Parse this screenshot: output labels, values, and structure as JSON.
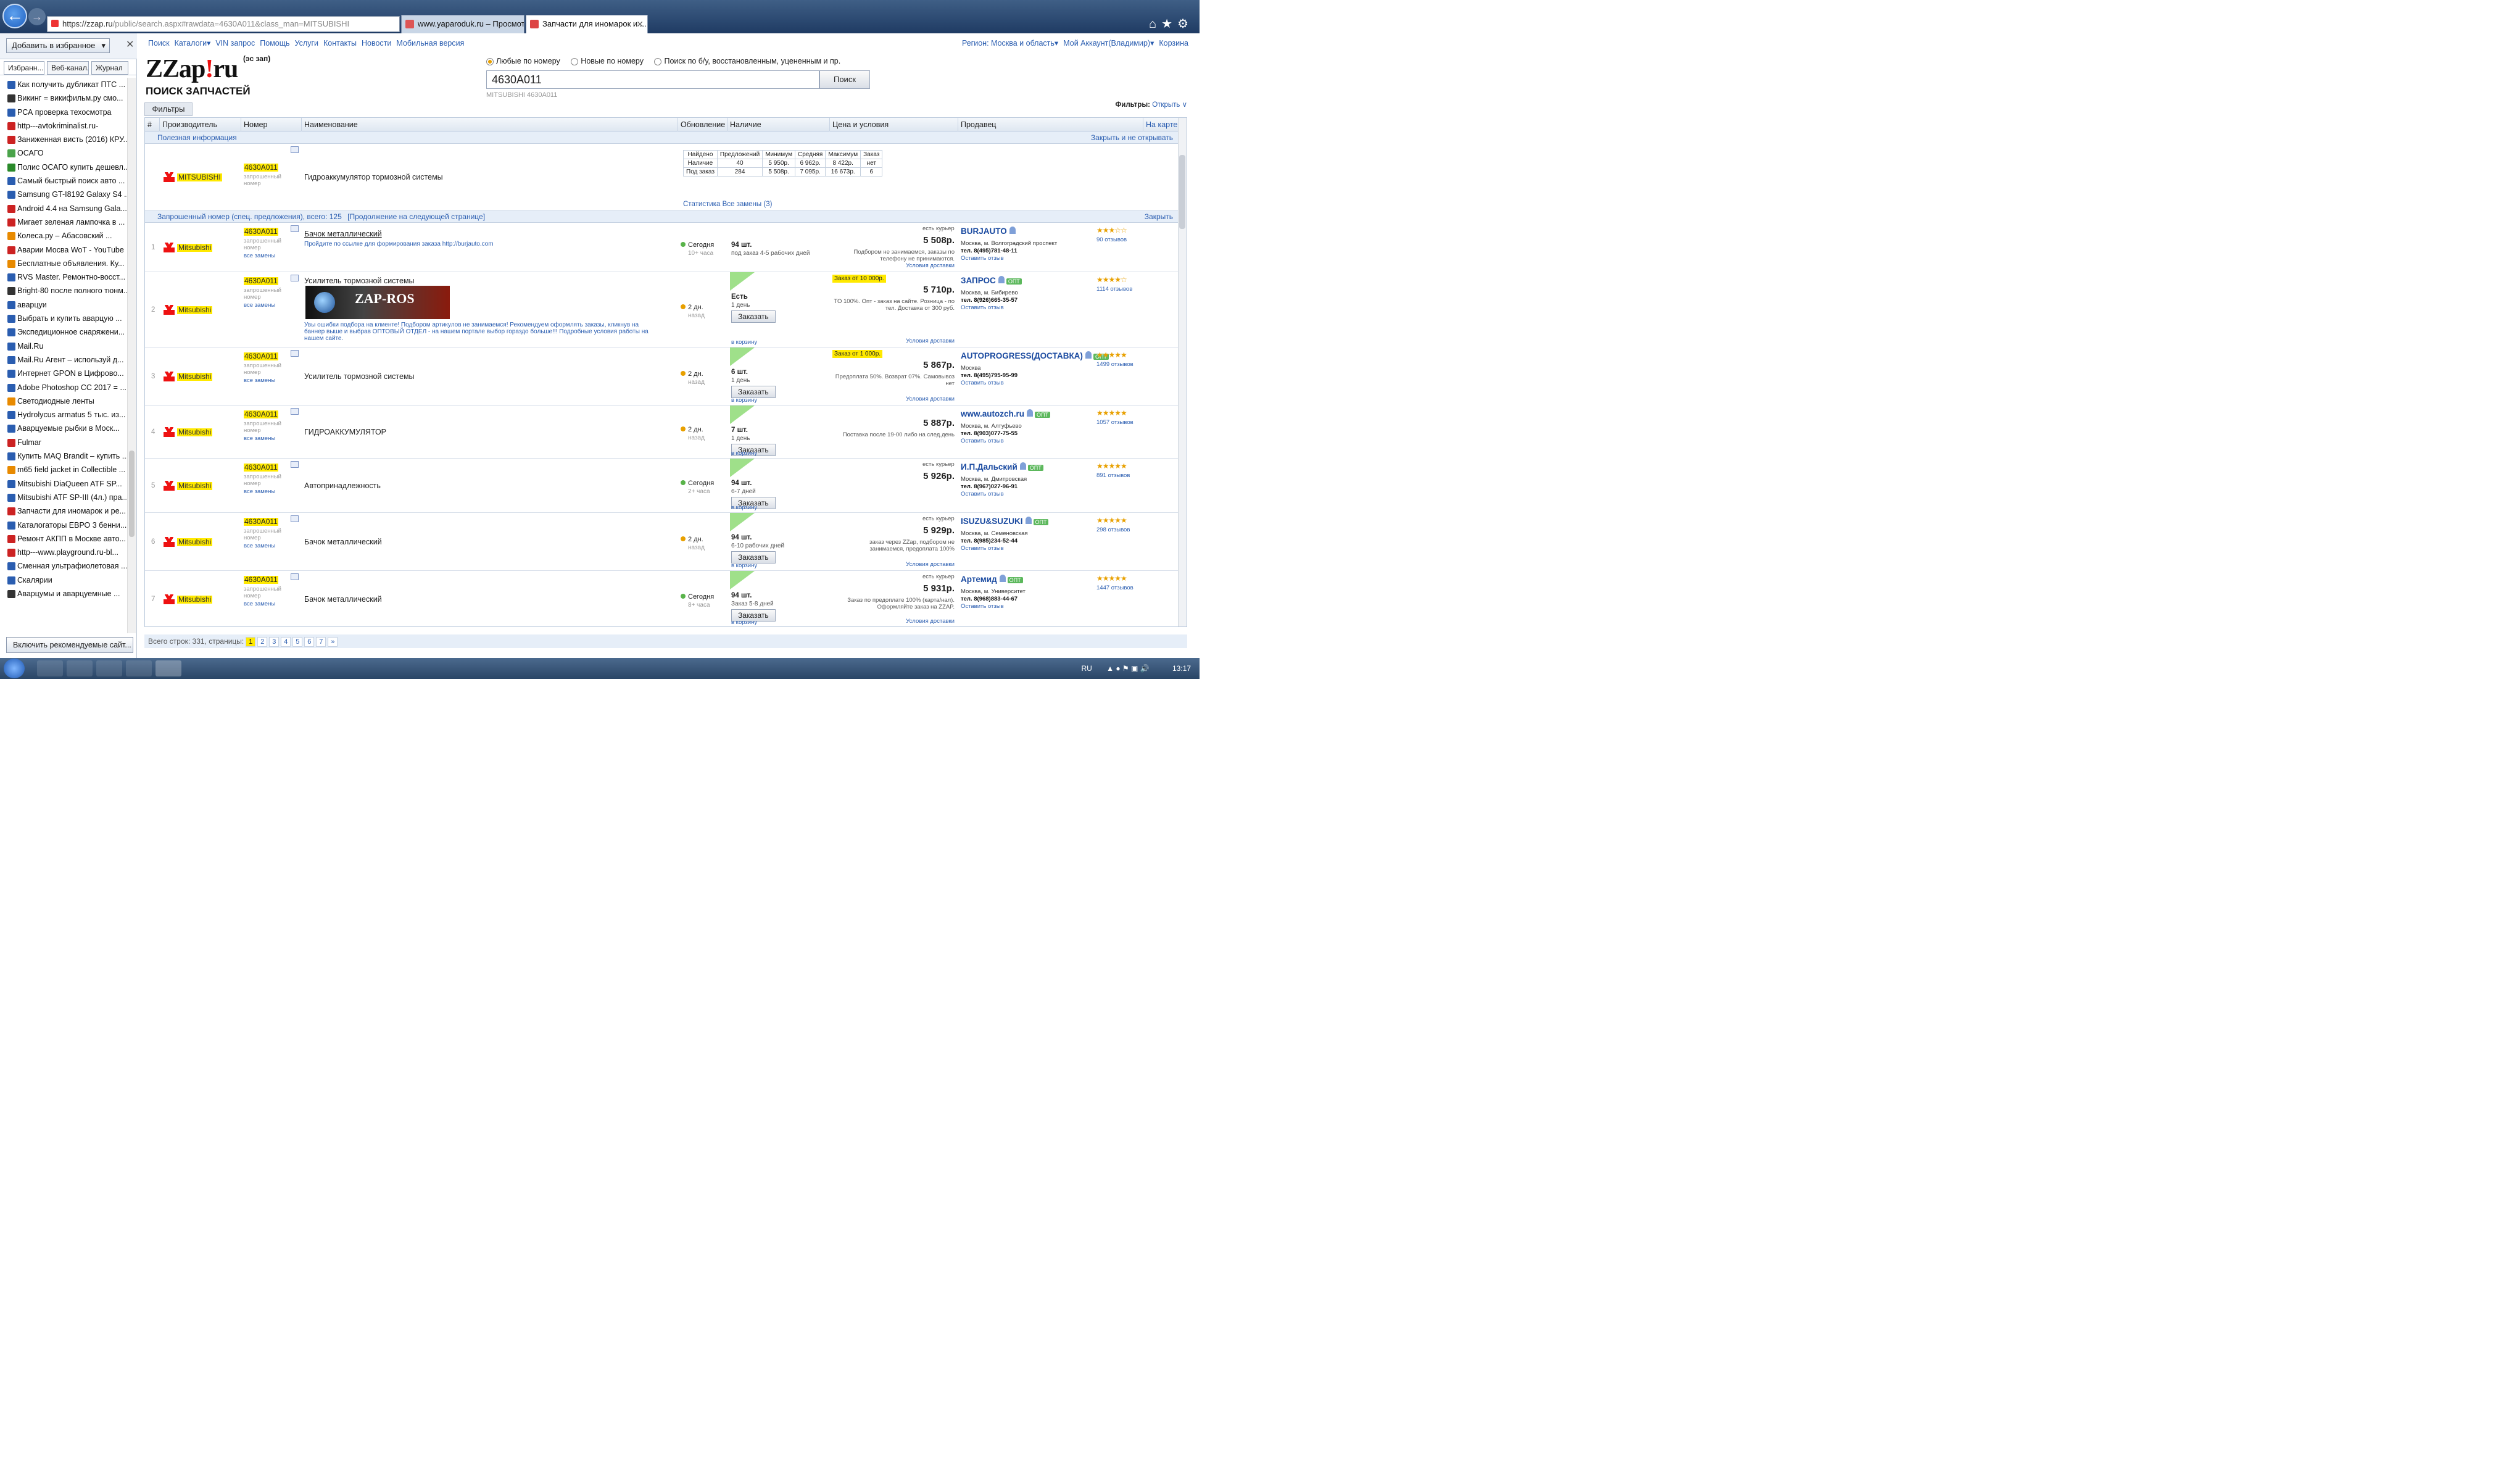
{
  "browser": {
    "url_prefix": "https://",
    "url_host": "zzap.ru",
    "url_rest": "/public/search.aspx#rawdata=4630A011&class_man=MITSUBISHI",
    "tabs": [
      {
        "label": "www.yaparoduk.ru – Просмотр..."
      },
      {
        "label": "Запчасти для иномарок и ..."
      }
    ]
  },
  "sidebar": {
    "add_favorites": "Добавить в избранное",
    "tabs": [
      "Избранн...",
      "Веб-канал...",
      "Журнал"
    ],
    "items": [
      {
        "label": "Как получить дубликат ПТС ...",
        "color": "#2a5db0"
      },
      {
        "label": "Викинг = викифильм.ру смо...",
        "color": "#333333"
      },
      {
        "label": "РСА проверка техосмотра",
        "color": "#2a5db0"
      },
      {
        "label": "http---avtokriminalist.ru-",
        "color": "#cc2222"
      },
      {
        "label": "Заниженная висть (2016) КРУ...",
        "color": "#cc2222"
      },
      {
        "label": "ОСАГО",
        "color": "#4aa34a"
      },
      {
        "label": "Полис ОСАГО купить дешевл...",
        "color": "#2a8a2a"
      },
      {
        "label": "Самый быстрый поиск авто ...",
        "color": "#2a5db0"
      },
      {
        "label": "Samsung GT-I8192 Galaxy S4 ...",
        "color": "#2a5db0"
      },
      {
        "label": "Android 4.4 на Samsung Gala...",
        "color": "#cc2222"
      },
      {
        "label": "Мигает зеленая лампочка в ...",
        "color": "#cc2222"
      },
      {
        "label": "Колеса.ру – Абасовский ...",
        "color": "#e88a00"
      },
      {
        "label": "Аварии Мосва WoT - YouTube",
        "color": "#cc2222"
      },
      {
        "label": "Бесплатные объявления. Ку...",
        "color": "#e88a00"
      },
      {
        "label": "RVS Master. Ремонтно-восст...",
        "color": "#2a5db0"
      },
      {
        "label": "Bright-80 после полного тюнм...",
        "color": "#333333"
      },
      {
        "label": "аварцуи",
        "color": "#2a5db0"
      },
      {
        "label": "Выбрать и купить аварцую ...",
        "color": "#2a5db0"
      },
      {
        "label": "Экспедиционное снаряжени...",
        "color": "#2a5db0"
      },
      {
        "label": "Mail.Ru",
        "color": "#2a5db0"
      },
      {
        "label": "Mail.Ru Агент – используй д...",
        "color": "#2a5db0"
      },
      {
        "label": "Интернет GPON в Цифрово...",
        "color": "#2a5db0"
      },
      {
        "label": "Adobe Photoshop CC 2017 = ...",
        "color": "#2a5db0"
      },
      {
        "label": "Светодиодные ленты",
        "color": "#e88a00"
      },
      {
        "label": "Hydrolycus armatus 5 тыс. из...",
        "color": "#2a5db0"
      },
      {
        "label": "Аварцуемые рыбки в Моск...",
        "color": "#2a5db0"
      },
      {
        "label": "Fulmar",
        "color": "#cc2222"
      },
      {
        "label": "Купить MAQ Brandit – купить ...",
        "color": "#2a5db0"
      },
      {
        "label": "m65 field jacket in Collectible ...",
        "color": "#e88a00"
      },
      {
        "label": "Mitsubishi DiaQueen ATF SP...",
        "color": "#2a5db0"
      },
      {
        "label": "Mitsubishi ATF SP-III (4л.) пра...",
        "color": "#2a5db0"
      },
      {
        "label": "Запчасти для иномарок и ре...",
        "color": "#cc2222"
      },
      {
        "label": "Каталогаторы ЕВРО 3 бенни...",
        "color": "#2a5db0"
      },
      {
        "label": "Ремонт АКПП в Москве авто...",
        "color": "#cc2222"
      },
      {
        "label": "http---www.playground.ru-bl...",
        "color": "#cc2222"
      },
      {
        "label": "Сменная ультрафиолетовая ...",
        "color": "#2a5db0"
      },
      {
        "label": "Скалярии",
        "color": "#2a5db0"
      },
      {
        "label": "Аварцумы и аварцуемные ...",
        "color": "#333333"
      }
    ],
    "recommend_button": "Включить рекомендуемые сайт..."
  },
  "site": {
    "nav": [
      "Поиск",
      "Каталоги▾",
      "VIN запрос",
      "Помощь",
      "Услуги",
      "Контакты",
      "Новости",
      "Мобильная версия"
    ],
    "region": "Регион: Москва и область▾",
    "account": "Мой Аккаунт(Владимир)▾",
    "cart": "Корзина",
    "logo_pre": "ZZap",
    "logo_bang": "!",
    "logo_post": "ru",
    "logo_sup": "(эс зап)",
    "subtitle": "ПОИСК ЗАПЧАСТЕЙ",
    "filters_button": "Фильтры",
    "radios": [
      "Любые по номеру",
      "Новые по номеру",
      "Поиск по б/у, восстановленным, уцененным и пр."
    ],
    "search_value": "4630A011",
    "search_button": "Поиск",
    "search_hint": "MITSUBISHI  4630A011",
    "filters_label": "Фильтры:",
    "filters_open": "Открыть"
  },
  "table": {
    "headers": [
      "#",
      "Производитель",
      "Номер",
      "Наименование",
      "Обновление",
      "Наличие",
      "Цена и условия",
      "Продавец",
      "На карте"
    ],
    "section_info": "Полезная информация",
    "section_info_close": "Закрыть и не открывать",
    "section_requested": "Запрошенный номер (спец. предложения), всего: 125",
    "section_requested_more": "[Продолжение на следующей странице]",
    "section_requested_close": "Закрыть",
    "info_row": {
      "brand": "MITSUBISHI",
      "number": "4630A011",
      "name": "Гидроаккумулятор тормозной системы",
      "stats_header": [
        "Найдено",
        "Предложений",
        "Минимум",
        "Средняя",
        "Максимум",
        "Заказ"
      ],
      "stats_rows": [
        [
          "Наличие",
          "40",
          "5 950р.",
          "6 962р.",
          "8 422р.",
          "нет"
        ],
        [
          "Под заказ",
          "284",
          "5 508р.",
          "7 095р.",
          "16 673р.",
          "6"
        ]
      ],
      "stats_links": "Статистика  Все замены (3)"
    },
    "rows": [
      {
        "n": "1",
        "brand": "Mitsubishi",
        "number": "4630A011",
        "sub": "запрошенный номер",
        "all": "все замены",
        "name": "Бачок металлический",
        "name_note": "Пройдите по ссылке для формирования заказа http://burjauto.com",
        "upd1": "Сегодня",
        "upd2": "10+ часа",
        "avail": "94 шт.",
        "avail2": "под заказ 4-5 рабочих дней",
        "cond_top": "есть курьер",
        "price": "5 508р.",
        "cond": "Подбором не занимаемся, заказы по телефону не принимаются.",
        "terms": "Условия доставки",
        "seller": "BURJAUTO",
        "city": "Москва, м. Волгоградский проспект",
        "phone": "тел. 8(495)781-48-11",
        "review": "Оставить отзыв",
        "rating": "★★★☆☆",
        "reviews": "90 отзывов"
      },
      {
        "n": "2",
        "brand": "Mitsubishi",
        "number": "4630A011",
        "sub": "запрошенный номер",
        "all": "все замены",
        "name": "Усилитель тормозной системы",
        "name_note": "Увы ошибки подбора на клиенте! Подбором артикулов не занимаемся! Рекомендуем оформлять заказы, кликнув на баннер выше и выбрав ОПТОВЫЙ ОТДЕЛ - на нашем портале выбор гораздо больше!!! Подробные условия работы на нашем сайте.",
        "upd1": "2 дн.",
        "upd2": "назад",
        "avail": "Есть",
        "avail2": "1 день",
        "order": "Заказать",
        "cart": "в корзину",
        "promo": "Заказ от 10 000р.",
        "price": "5 710р.",
        "cond": "ТО 100%. Опт - заказ на сайте. Розница - по тел. Доставка от 300 руб.",
        "terms": "Условия доставки",
        "seller": "ЗАПРОС",
        "badge": "ОПТ",
        "city": "Москва, м. Бибирево",
        "phone": "тел. 8(926)665-35-57",
        "review": "Оставить отзыв",
        "rating": "★★★★☆",
        "reviews": "1114 отзывов",
        "banner": "ZAP-ROS"
      },
      {
        "n": "3",
        "brand": "Mitsubishi",
        "number": "4630A011",
        "sub": "запрошенный номер",
        "all": "все замены",
        "name": "Усилитель тормозной системы",
        "upd1": "2 дн.",
        "upd2": "назад",
        "avail": "6 шт.",
        "avail2": "1 день",
        "order": "Заказать",
        "cart": "в корзину",
        "promo": "Заказ от 1 000р.",
        "price": "5 867р.",
        "cond": "Предоплата 50%. Возврат 07%. Самовывоз нет",
        "terms": "Условия доставки",
        "seller": "AUTOPROGRESS(ДОСТАВКА)",
        "badge": "ОПТ",
        "city": "Москва",
        "phone": "тел. 8(495)795-95-99",
        "review": "Оставить отзыв",
        "rating": "★★★★★",
        "reviews": "1499 отзывов"
      },
      {
        "n": "4",
        "brand": "Mitsubishi",
        "number": "4630A011",
        "sub": "запрошенный номер",
        "all": "все замены",
        "name": "ГИДРОАККУМУЛЯТОР",
        "upd1": "2 дн.",
        "upd2": "назад",
        "avail": "7 шт.",
        "avail2": "1 день",
        "order": "Заказать",
        "cart": "в корзину",
        "price": "5 887р.",
        "cond": "Поставка после 19-00 либо на след.день",
        "terms": "",
        "seller": "www.autozch.ru",
        "badge": "ОПТ",
        "city": "Москва, м. Алтуфьево",
        "phone": "тел. 8(903)077-75-55",
        "review": "Оставить отзыв",
        "rating": "★★★★★",
        "reviews": "1057 отзывов"
      },
      {
        "n": "5",
        "brand": "Mitsubishi",
        "number": "4630A011",
        "sub": "запрошенный номер",
        "all": "все замены",
        "name": "Автопринадлежность",
        "upd1": "Сегодня",
        "upd2": "2+ часа",
        "avail": "94 шт.",
        "avail2": "6-7 дней",
        "order": "Заказать",
        "cart": "в корзину",
        "cond_top": "есть курьер",
        "price": "5 926р.",
        "cond": "",
        "terms": "",
        "seller": "И.П.Дальский",
        "badge": "ОПТ",
        "city": "Москва, м. Дмитровская",
        "phone": "тел. 8(967)027-96-91",
        "review": "Оставить отзыв",
        "rating": "★★★★★",
        "reviews": "891 отзывов"
      },
      {
        "n": "6",
        "brand": "Mitsubishi",
        "number": "4630A011",
        "sub": "запрошенный номер",
        "all": "все замены",
        "name": "Бачок металлический",
        "upd1": "2 дн.",
        "upd2": "назад",
        "avail": "94 шт.",
        "avail2": "6-10 рабочих дней",
        "order": "Заказать",
        "cart": "в корзину",
        "cond_top": "есть курьер",
        "price": "5 929р.",
        "cond": "заказ через ZZap, подбором не занимаемся, предоплата 100%",
        "terms": "Условия доставки",
        "seller": "ISUZU&SUZUKI",
        "badge": "ОПТ",
        "city": "Москва, м. Семеновская",
        "phone": "тел. 8(985)234-52-44",
        "review": "Оставить отзыв",
        "rating": "★★★★★",
        "reviews": "298 отзывов"
      },
      {
        "n": "7",
        "brand": "Mitsubishi",
        "number": "4630A011",
        "sub": "запрошенный номер",
        "all": "все замены",
        "name": "Бачок металлический",
        "upd1": "Сегодня",
        "upd2": "8+ часа",
        "avail": "94 шт.",
        "avail2": "Заказ 5-8 дней",
        "order": "Заказать",
        "cart": "в корзину",
        "cond_top": "есть курьер",
        "price": "5 931р.",
        "cond": "Заказ по предоплате 100% (карта/нал). Оформляйте заказ на ZZAP.",
        "terms": "Условия доставки",
        "seller": "Артемид",
        "badge": "ОПТ",
        "city": "Москва, м. Университет",
        "phone": "тел. 8(968)883-44-67",
        "review": "Оставить отзыв",
        "rating": "★★★★★",
        "reviews": "1447 отзывов"
      }
    ],
    "pager_label": "Всего строк: 331, страницы:",
    "pages": [
      "1",
      "2",
      "3",
      "4",
      "5",
      "6",
      "7"
    ],
    "pager_next": "»"
  },
  "taskbar": {
    "lang": "RU",
    "time": "13:17"
  }
}
